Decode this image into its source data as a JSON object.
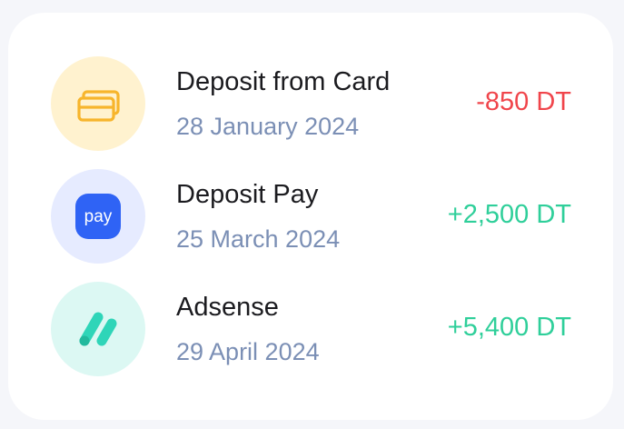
{
  "transactions": [
    {
      "title": "Deposit from Card",
      "date": "28 January 2024",
      "amount": "-850 DT",
      "icon": "card-icon",
      "icon_bg": "#fff2cf",
      "amount_color": "#f0454b"
    },
    {
      "title": "Deposit Pay",
      "date": "25 March 2024",
      "amount": "+2,500 DT",
      "icon": "samsung-pay-icon",
      "icon_label": "pay",
      "icon_bg": "#e6ebff",
      "amount_color": "#2fcf9a"
    },
    {
      "title": "Adsense",
      "date": "29 April 2024",
      "amount": "+5,400 DT",
      "icon": "adsense-icon",
      "icon_bg": "#dcf8f3",
      "amount_color": "#2fcf9a"
    }
  ]
}
